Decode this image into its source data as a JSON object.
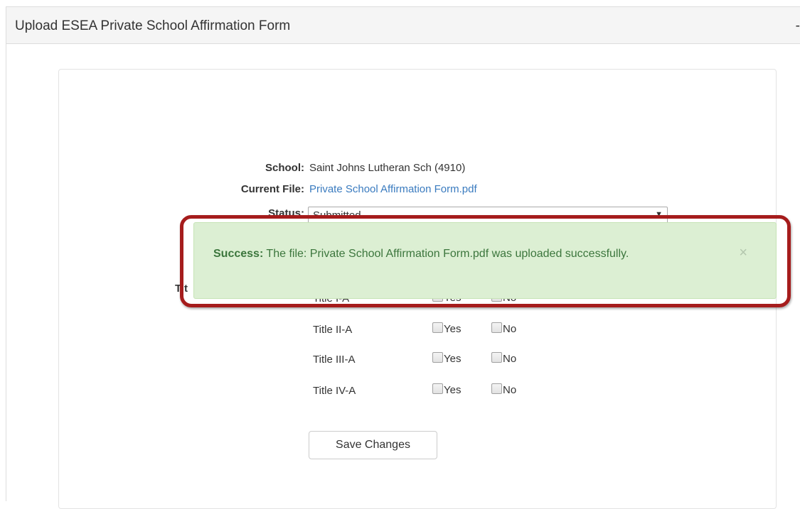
{
  "panel": {
    "title": "Upload ESEA Private School Affirmation Form",
    "collapse_glyph": "-"
  },
  "form": {
    "school_label": "School:",
    "school_value": "Saint Johns Lutheran Sch (4910)",
    "current_file_label": "Current File:",
    "current_file_value": "Private School Affirmation Form.pdf",
    "status_label": "Status:",
    "status_value": "Submitted",
    "hidden_label_fragment": "Tit",
    "titles": [
      {
        "name": "Title I-A",
        "yes": "Yes",
        "no": "No"
      },
      {
        "name": "Title II-A",
        "yes": "Yes",
        "no": "No"
      },
      {
        "name": "Title III-A",
        "yes": "Yes",
        "no": "No"
      },
      {
        "name": "Title IV-A",
        "yes": "Yes",
        "no": "No"
      }
    ],
    "save_label": "Save Changes"
  },
  "alert": {
    "prefix": "Success:",
    "message": "The file: Private School Affirmation Form.pdf was uploaded successfully.",
    "close_glyph": "×"
  },
  "colors": {
    "alert_bg": "#dcefd3",
    "alert_text": "#3c763d",
    "highlight_outline": "#a51c1c",
    "link": "#3a7bbf"
  }
}
